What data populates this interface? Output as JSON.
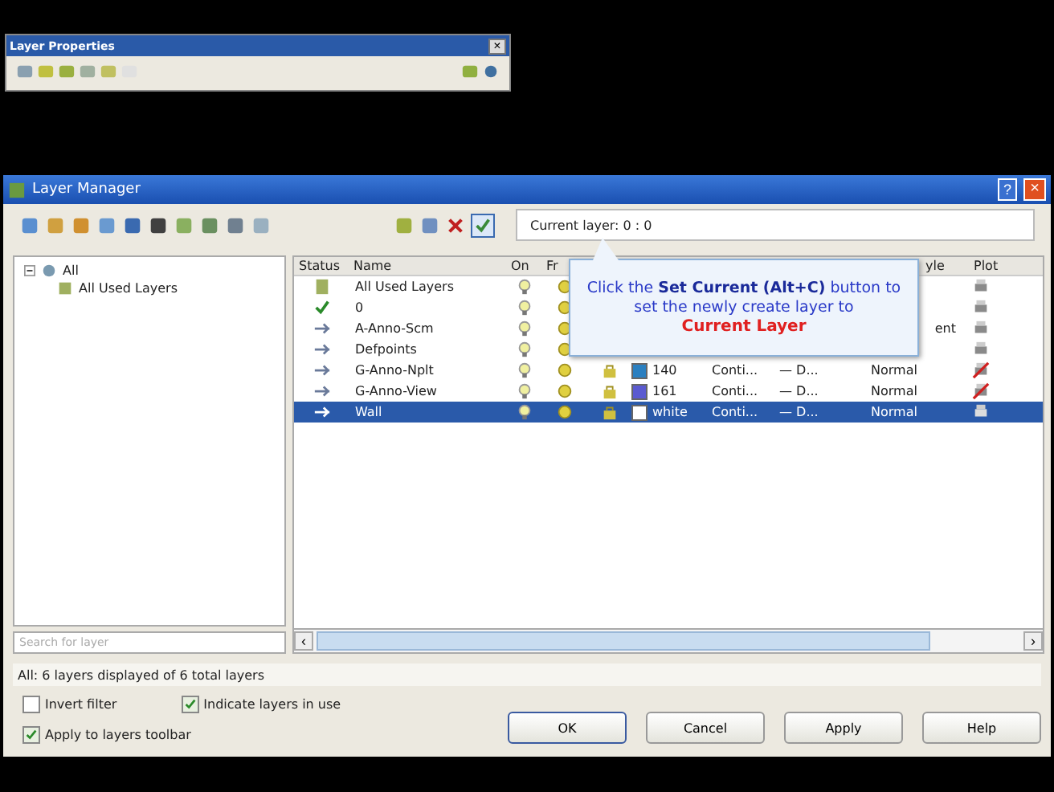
{
  "palette": {
    "title": "Layer Properties",
    "close": "×"
  },
  "window": {
    "title": "Layer Manager",
    "help": "?",
    "close": "×"
  },
  "current_layer": "Current layer: 0 : 0",
  "tree": [
    {
      "label": "All",
      "expanded": true,
      "children": [
        {
          "label": "All Used Layers"
        }
      ]
    }
  ],
  "search": {
    "placeholder": "Search for layer"
  },
  "table": {
    "columns": [
      "Status",
      "Name",
      "On",
      "Fr",
      "yle",
      "Plot"
    ],
    "rows": [
      {
        "kind": "all",
        "name": "All Used Layers",
        "on": true,
        "frozen": false,
        "plot": true,
        "selected": false
      },
      {
        "kind": "current",
        "name": "0",
        "on": true,
        "frozen": false,
        "plot": true,
        "selected": false
      },
      {
        "kind": "layer",
        "name": "A-Anno-Scm",
        "on": true,
        "frozen": false,
        "plot_style": "ent",
        "plot": true,
        "selected": false
      },
      {
        "kind": "layer",
        "name": "Defpoints",
        "on": true,
        "frozen": false,
        "plot": true,
        "selected": false
      },
      {
        "kind": "layer",
        "name": "G-Anno-Nplt",
        "on": true,
        "frozen": false,
        "color": "#2a7fc0",
        "color_name": "140",
        "linetype": "Conti...",
        "lineweight": "— D...",
        "plot_style": "Normal",
        "plot": false,
        "selected": false
      },
      {
        "kind": "layer",
        "name": "G-Anno-View",
        "on": true,
        "frozen": false,
        "color": "#5a5ad0",
        "color_name": "161",
        "linetype": "Conti...",
        "lineweight": "— D...",
        "plot_style": "Normal",
        "plot": false,
        "selected": false
      },
      {
        "kind": "layer",
        "name": "Wall",
        "on": true,
        "frozen": false,
        "color": "#ffffff",
        "color_name": "white",
        "linetype": "Conti...",
        "lineweight": "— D...",
        "plot_style": "Normal",
        "plot": true,
        "selected": true
      }
    ]
  },
  "callout": {
    "text": "Click the **Set Current (Alt+C)** button to set the newly create layer to",
    "emphasis": "Current Layer"
  },
  "scroll": {
    "left": "‹",
    "right": "›"
  },
  "status_line": "All: 6 layers displayed of 6 total layers",
  "options": [
    {
      "label": "Invert filter",
      "checked": false
    },
    {
      "label": "Indicate layers in use",
      "checked": true
    },
    {
      "label": "Apply to layers toolbar",
      "checked": true
    }
  ],
  "buttons": [
    "OK",
    "Cancel",
    "Apply",
    "Help"
  ]
}
